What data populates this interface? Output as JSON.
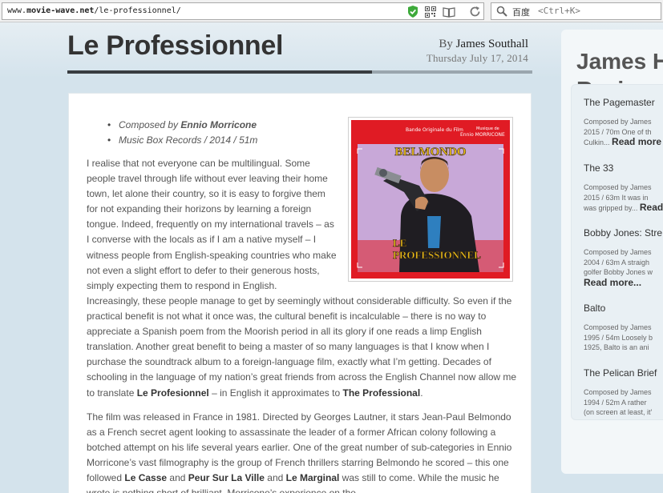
{
  "browser": {
    "url_prefix": "www.",
    "url_domain": "movie-wave.net",
    "url_path": "/le-professionnel/",
    "search_engine": "百度",
    "search_hint": "<Ctrl+K>"
  },
  "post": {
    "title": "Le Professionnel",
    "by_label": "By",
    "author": "James Southall",
    "date": "Thursday July 17, 2014",
    "composer_prefix": "Composed by",
    "composer": "Ennio Morricone",
    "release_info": "Music Box Records / 2014 / 51m"
  },
  "cover": {
    "top_left": "Bande Originale du Film",
    "top_right_1": "Musique de",
    "top_right_2": "Ennio MORRICONE",
    "actor": "BELMONDO",
    "film_line_1": "LE",
    "film_line_2": "PROFESSIONNEL",
    "colors": {
      "background": "#e01b24",
      "title_yellow": "#f2c31a",
      "sky": "#c8a8d8"
    }
  },
  "article": {
    "p1_left": "I realise that not everyone can be multilingual.  Some people travel through life without ever leaving their home town, let alone their country, so it is easy to forgive them for not expanding their horizons by learning a foreign tongue.  Indeed, frequently on my international travels – as I converse with the locals as if I am a native myself – I witness people from English-speaking countries who make not even a slight effort to defer to their generous hosts, simply expecting them to respond in English.",
    "p1_cont_a": " Increasingly, these people manage to get by seemingly without considerable difficulty.  So even if the practical benefit is not what it once was, the cultural benefit is incalculable – there is no way to appreciate a Spanish poem from the Moorish period in all its glory if one reads a limp English translation.  Another great benefit to being a master of so many languages is that I know when I purchase the soundtrack album to a foreign-language film, exactly what I’m getting.  Decades of schooling in the language of my nation’s great friends from across the English Channel now allow me to translate ",
    "p1_bold_1": "Le Profesionnel",
    "p1_cont_b": " – in English it approximates to ",
    "p1_bold_2": "The Professional",
    "p1_end": ".",
    "p2_a": "The film was released in France in 1981.  Directed by Georges Lautner, it stars Jean-Paul Belmondo as a French secret agent looking to assassinate the leader of a former African colony following a botched attempt on his life several years earlier.  One of the great number of sub-categories in Ennio Morricone’s vast filmography is the group of French thrillers starring Belmondo he scored – this one followed ",
    "p2_bold_1": "Le Casse",
    "p2_b": " and ",
    "p2_bold_2": "Peur Sur La Ville",
    "p2_c": " and ",
    "p2_bold_3": "Le Marginal",
    "p2_d": " was still to come.  While the music he wrote is nothing short of brilliant, Morricone’s experience on the"
  },
  "sidebar": {
    "title_line_1": "James H",
    "title_line_2": "Review",
    "reviews": [
      {
        "name": "The Pagemaster",
        "line1": "Composed by James",
        "line2": "2015 / 70m One of th",
        "line3": "Culkin...",
        "more": "Read more"
      },
      {
        "name": "The 33",
        "line1": "Composed by James",
        "line2": "2015 / 63m It was in",
        "line3": "was gripped by...",
        "more": "Read more"
      },
      {
        "name": "Bobby Jones: Stre",
        "line1": "Composed by James",
        "line2": "2004 / 63m A straigh",
        "line3": "golfer Bobby Jones w",
        "more": "Read more..."
      },
      {
        "name": "Balto",
        "line1": "Composed by James",
        "line2": "1995 / 54m Loosely b",
        "line3": "1925, Balto is an ani",
        "more": ""
      },
      {
        "name": "The Pelican Brief",
        "line1": "Composed by James",
        "line2": "1994 / 52m A rather",
        "line3": "(on screen at least, it'",
        "more": ""
      }
    ]
  }
}
